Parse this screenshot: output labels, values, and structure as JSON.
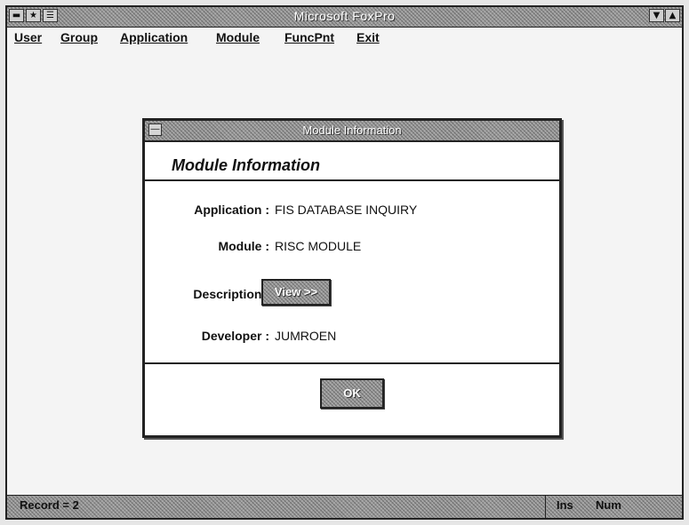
{
  "app": {
    "title": "Microsoft FoxPro",
    "menu": [
      {
        "label": "User"
      },
      {
        "label": "Group"
      },
      {
        "label": "Application"
      },
      {
        "label": "Module"
      },
      {
        "label": "FuncPnt"
      },
      {
        "label": "Exit"
      }
    ],
    "status": {
      "record": "Record = 2",
      "ins": "Ins",
      "num": "Num"
    }
  },
  "dialog": {
    "title": "Module Information",
    "heading": "Module Information",
    "fields": {
      "application_label": "Application :",
      "application_value": "FIS DATABASE INQUIRY",
      "module_label": "Module :",
      "module_value": "RISC MODULE",
      "description_label": "Description :",
      "view_button": "View >>",
      "developer_label": "Developer :",
      "developer_value": "JUMROEN"
    },
    "ok_button": "OK"
  }
}
